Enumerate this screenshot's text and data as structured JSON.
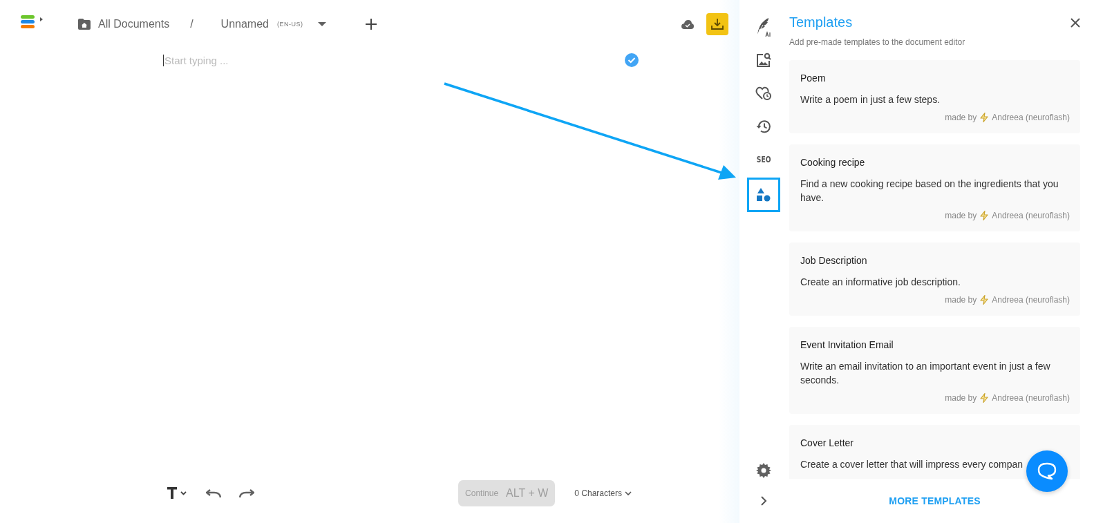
{
  "breadcrumb": {
    "folder": "All Documents",
    "separator": "/",
    "document": "Unnamed",
    "language": "(EN-US)"
  },
  "editor": {
    "placeholder": "Start typing ..."
  },
  "toolbar": {
    "continue": "Continue",
    "shortcut": "ALT + W",
    "continue_disabled": true,
    "characters": "0 Characters"
  },
  "rail": [
    {
      "kind": "ai-writer",
      "selected": false
    },
    {
      "kind": "image-search",
      "selected": false
    },
    {
      "kind": "favorites",
      "selected": false
    },
    {
      "kind": "history",
      "selected": false
    },
    {
      "kind": "seo",
      "label": "SEO",
      "selected": false
    },
    {
      "kind": "templates",
      "selected": true
    }
  ],
  "panel": {
    "title": "Templates",
    "subtitle": "Add pre-made templates to the document editor",
    "templates": [
      {
        "title": "Poem",
        "description": "Write a poem in just a few steps.",
        "made_by": "made by",
        "author": "Andreea (neuroflash)"
      },
      {
        "title": "Cooking recipe",
        "description": "Find a new cooking recipe based on the ingredients that you have.",
        "made_by": "made by",
        "author": "Andreea (neuroflash)"
      },
      {
        "title": "Job Description",
        "description": "Create an informative job description.",
        "made_by": "made by",
        "author": "Andreea (neuroflash)"
      },
      {
        "title": "Event Invitation Email",
        "description": "Write an email invitation to an important event in just a few seconds.",
        "made_by": "made by",
        "author": "Andreea (neuroflash)"
      },
      {
        "title": "Cover Letter",
        "description": "Create a cover letter that will impress every compan"
      }
    ],
    "more": "MORE TEMPLATES"
  }
}
